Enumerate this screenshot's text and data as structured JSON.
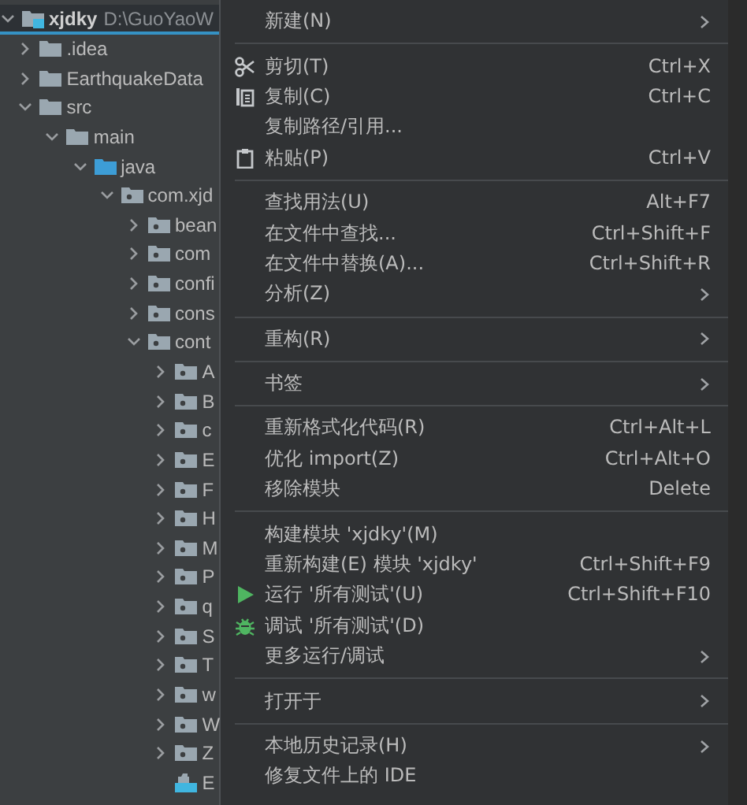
{
  "project_tree": {
    "label": "xjdky",
    "path": "D:\\GuoYaoW",
    "kind": "module",
    "expanded": true,
    "selected": true,
    "children": [
      {
        "label": ".idea",
        "kind": "folder",
        "expanded": false,
        "selected": false
      },
      {
        "label": "EarthquakeData",
        "kind": "folder",
        "expanded": false,
        "selected": false
      },
      {
        "label": "src",
        "kind": "folder",
        "expanded": true,
        "selected": false,
        "children": [
          {
            "label": "main",
            "kind": "folder",
            "expanded": true,
            "selected": false,
            "children": [
              {
                "label": "java",
                "kind": "source",
                "expanded": true,
                "selected": false,
                "children": [
                  {
                    "label": "com.xjd",
                    "kind": "package",
                    "expanded": true,
                    "selected": false,
                    "children": [
                      {
                        "label": "bean",
                        "kind": "package",
                        "expanded": false,
                        "selected": false
                      },
                      {
                        "label": "com",
                        "kind": "package",
                        "expanded": false,
                        "selected": false
                      },
                      {
                        "label": "confi",
                        "kind": "package",
                        "expanded": false,
                        "selected": false
                      },
                      {
                        "label": "cons",
                        "kind": "package",
                        "expanded": false,
                        "selected": false
                      },
                      {
                        "label": "cont",
                        "kind": "package",
                        "expanded": true,
                        "selected": false,
                        "children": [
                          {
                            "label": "A",
                            "kind": "package",
                            "expanded": false,
                            "selected": false
                          },
                          {
                            "label": "B",
                            "kind": "package",
                            "expanded": false,
                            "selected": false
                          },
                          {
                            "label": "c",
                            "kind": "package",
                            "expanded": false,
                            "selected": false
                          },
                          {
                            "label": "E",
                            "kind": "package",
                            "expanded": false,
                            "selected": false
                          },
                          {
                            "label": "F",
                            "kind": "package",
                            "expanded": false,
                            "selected": false
                          },
                          {
                            "label": "H",
                            "kind": "package",
                            "expanded": false,
                            "selected": false
                          },
                          {
                            "label": "M",
                            "kind": "package",
                            "expanded": false,
                            "selected": false
                          },
                          {
                            "label": "P",
                            "kind": "package",
                            "expanded": false,
                            "selected": false
                          },
                          {
                            "label": "q",
                            "kind": "package",
                            "expanded": false,
                            "selected": false
                          },
                          {
                            "label": "S",
                            "kind": "package",
                            "expanded": false,
                            "selected": false
                          },
                          {
                            "label": "T",
                            "kind": "package",
                            "expanded": false,
                            "selected": false
                          },
                          {
                            "label": "w",
                            "kind": "package",
                            "expanded": false,
                            "selected": false
                          },
                          {
                            "label": "W",
                            "kind": "package",
                            "expanded": false,
                            "selected": false
                          },
                          {
                            "label": "Z",
                            "kind": "package",
                            "expanded": false,
                            "selected": false
                          },
                          {
                            "label": "E",
                            "kind": "file",
                            "selected": false
                          }
                        ]
                      }
                    ]
                  }
                ]
              }
            ]
          }
        ]
      }
    ]
  },
  "context_menu": [
    {
      "kind": "item",
      "label": "新建(N)",
      "submenu": true
    },
    {
      "kind": "separator"
    },
    {
      "kind": "cut",
      "label": "剪切(T)",
      "shortcut": "Ctrl+X"
    },
    {
      "kind": "copy",
      "label": "复制(C)",
      "shortcut": "Ctrl+C"
    },
    {
      "kind": "item",
      "label": "复制路径/引用..."
    },
    {
      "kind": "paste",
      "label": "粘贴(P)",
      "shortcut": "Ctrl+V"
    },
    {
      "kind": "separator"
    },
    {
      "kind": "item",
      "label": "查找用法(U)",
      "shortcut": "Alt+F7"
    },
    {
      "kind": "item",
      "label": "在文件中查找...",
      "shortcut": "Ctrl+Shift+F"
    },
    {
      "kind": "item",
      "label": "在文件中替换(A)...",
      "shortcut": "Ctrl+Shift+R"
    },
    {
      "kind": "item",
      "label": "分析(Z)",
      "submenu": true
    },
    {
      "kind": "separator"
    },
    {
      "kind": "item",
      "label": "重构(R)",
      "submenu": true
    },
    {
      "kind": "separator"
    },
    {
      "kind": "item",
      "label": "书签",
      "submenu": true
    },
    {
      "kind": "separator"
    },
    {
      "kind": "item",
      "label": "重新格式化代码(R)",
      "shortcut": "Ctrl+Alt+L"
    },
    {
      "kind": "item",
      "label": "优化 import(Z)",
      "shortcut": "Ctrl+Alt+O"
    },
    {
      "kind": "item",
      "label": "移除模块",
      "shortcut": "Delete"
    },
    {
      "kind": "separator"
    },
    {
      "kind": "item",
      "label": "构建模块 'xjdky'(M)"
    },
    {
      "kind": "item",
      "label": "重新构建(E) 模块 'xjdky'",
      "shortcut": "Ctrl+Shift+F9"
    },
    {
      "kind": "run",
      "label": "运行 '所有测试'(U)",
      "shortcut": "Ctrl+Shift+F10"
    },
    {
      "kind": "debug",
      "label": "调试 '所有测试'(D)"
    },
    {
      "kind": "item",
      "label": "更多运行/调试",
      "submenu": true
    },
    {
      "kind": "separator"
    },
    {
      "kind": "item",
      "label": "打开于",
      "submenu": true
    },
    {
      "kind": "separator"
    },
    {
      "kind": "item",
      "label": "本地历史记录(H)",
      "submenu": true
    },
    {
      "kind": "item",
      "label": "修复文件上的 IDE"
    }
  ]
}
